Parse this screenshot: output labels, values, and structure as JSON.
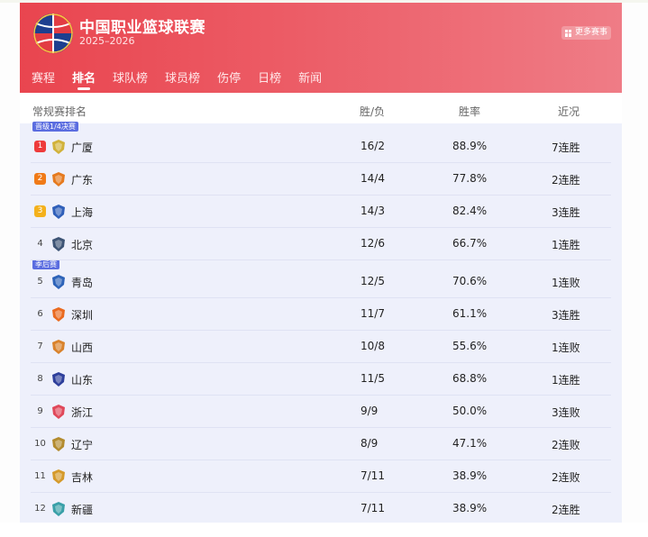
{
  "header": {
    "title": "中国职业篮球联赛",
    "season": "2025–2026",
    "more_label": "更多赛事"
  },
  "tabs": [
    {
      "label": "赛程",
      "active": false
    },
    {
      "label": "排名",
      "active": true
    },
    {
      "label": "球队榜",
      "active": false
    },
    {
      "label": "球员榜",
      "active": false
    },
    {
      "label": "伤停",
      "active": false
    },
    {
      "label": "日榜",
      "active": false
    },
    {
      "label": "新闻",
      "active": false
    }
  ],
  "table": {
    "section_label": "常规赛排名",
    "col_wl": "胜/负",
    "col_pct": "胜率",
    "col_streak": "近况",
    "zones": {
      "quarterfinal": "晋级1/4决赛",
      "playoff": "季后赛"
    },
    "rows": [
      {
        "rank": "1",
        "team": "广厦",
        "wl": "16/2",
        "pct": "88.9%",
        "streak": "7连胜",
        "badge_color": "#d1b23a",
        "rank_color": "#ee3b3b"
      },
      {
        "rank": "2",
        "team": "广东",
        "wl": "14/4",
        "pct": "77.8%",
        "streak": "2连胜",
        "badge_color": "#e57a1f",
        "rank_color": "#f07a18"
      },
      {
        "rank": "3",
        "team": "上海",
        "wl": "14/3",
        "pct": "82.4%",
        "streak": "3连胜",
        "badge_color": "#2f5fb9",
        "rank_color": "#f4b11c"
      },
      {
        "rank": "4",
        "team": "北京",
        "wl": "12/6",
        "pct": "66.7%",
        "streak": "1连胜",
        "badge_color": "#3d5475",
        "rank_color": ""
      },
      {
        "rank": "5",
        "team": "青岛",
        "wl": "12/5",
        "pct": "70.6%",
        "streak": "1连败",
        "badge_color": "#2d63b8",
        "rank_color": ""
      },
      {
        "rank": "6",
        "team": "深圳",
        "wl": "11/7",
        "pct": "61.1%",
        "streak": "3连胜",
        "badge_color": "#ea6a1f",
        "rank_color": ""
      },
      {
        "rank": "7",
        "team": "山西",
        "wl": "10/8",
        "pct": "55.6%",
        "streak": "1连败",
        "badge_color": "#d9822b",
        "rank_color": ""
      },
      {
        "rank": "8",
        "team": "山东",
        "wl": "11/5",
        "pct": "68.8%",
        "streak": "1连胜",
        "badge_color": "#2e3f9b",
        "rank_color": ""
      },
      {
        "rank": "9",
        "team": "浙江",
        "wl": "9/9",
        "pct": "50.0%",
        "streak": "3连败",
        "badge_color": "#e0485a",
        "rank_color": ""
      },
      {
        "rank": "10",
        "team": "辽宁",
        "wl": "8/9",
        "pct": "47.1%",
        "streak": "2连败",
        "badge_color": "#b38b2e",
        "rank_color": ""
      },
      {
        "rank": "11",
        "team": "吉林",
        "wl": "7/11",
        "pct": "38.9%",
        "streak": "2连败",
        "badge_color": "#d59a2a",
        "rank_color": ""
      },
      {
        "rank": "12",
        "team": "新疆",
        "wl": "7/11",
        "pct": "38.9%",
        "streak": "2连胜",
        "badge_color": "#3aa0a8",
        "rank_color": ""
      }
    ]
  }
}
